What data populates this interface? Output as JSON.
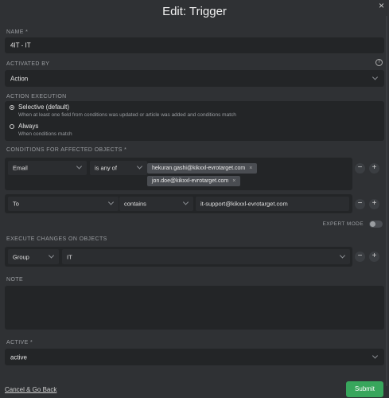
{
  "dialog": {
    "title": "Edit: Trigger",
    "close_label": "×"
  },
  "name": {
    "label": "NAME *",
    "value": "4IT - IT"
  },
  "activated_by": {
    "label": "ACTIVATED BY",
    "value": "Action",
    "help_label": "?"
  },
  "action_execution": {
    "label": "ACTION EXECUTION",
    "options": [
      {
        "label": "Selective (default)",
        "description": "When at least one field from conditions was updated or article was added and conditions match",
        "selected": true
      },
      {
        "label": "Always",
        "description": "When conditions match",
        "selected": false
      }
    ]
  },
  "conditions": {
    "label": "CONDITIONS FOR AFFECTED OBJECTS *",
    "rows": [
      {
        "attribute": "Email",
        "operator": "is any of",
        "values": [
          "hekuran.gashi@kikxxl-evrotarget.com",
          "jon.doe@kikxxl-evrotarget.com"
        ]
      },
      {
        "attribute": "To",
        "operator": "contains",
        "text": "it-support@kikxxl-evrotarget.com"
      }
    ],
    "minus_label": "−",
    "plus_label": "+",
    "expert_mode_label": "EXPERT MODE"
  },
  "execute": {
    "label": "EXECUTE CHANGES ON OBJECTS",
    "attribute": "Group",
    "value": "IT"
  },
  "note": {
    "label": "NOTE",
    "value": ""
  },
  "active": {
    "label": "ACTIVE *",
    "value": "active"
  },
  "footer": {
    "cancel_label": "Cancel & Go Back",
    "submit_label": "Submit"
  },
  "colors": {
    "submit": "#38a65c",
    "background": "#2f3134",
    "field": "#232527"
  }
}
